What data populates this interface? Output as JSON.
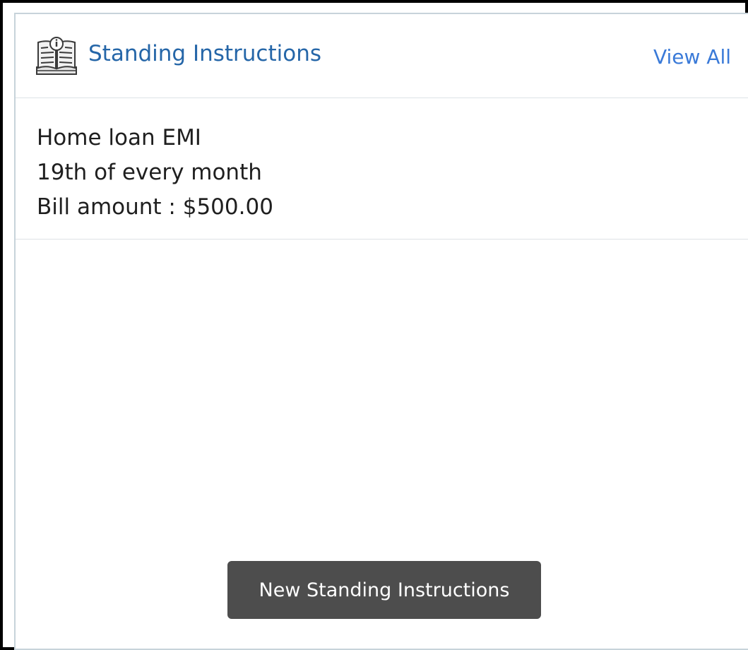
{
  "widget": {
    "title": "Standing Instructions",
    "icon": "instruction-book-icon",
    "view_all_label": "View All",
    "new_button_label": "New Standing Instructions"
  },
  "instructions": [
    {
      "name": "Home loan EMI",
      "schedule": "19th of every month",
      "amount": "Bill amount : $500.00"
    }
  ],
  "colors": {
    "title": "#2566a8",
    "link": "#3a7ad8",
    "button_bg": "#4d4d4d",
    "button_text": "#ffffff",
    "card_border": "#c7d3da",
    "divider": "#dde2e6",
    "body_text": "#1f1f1f"
  }
}
